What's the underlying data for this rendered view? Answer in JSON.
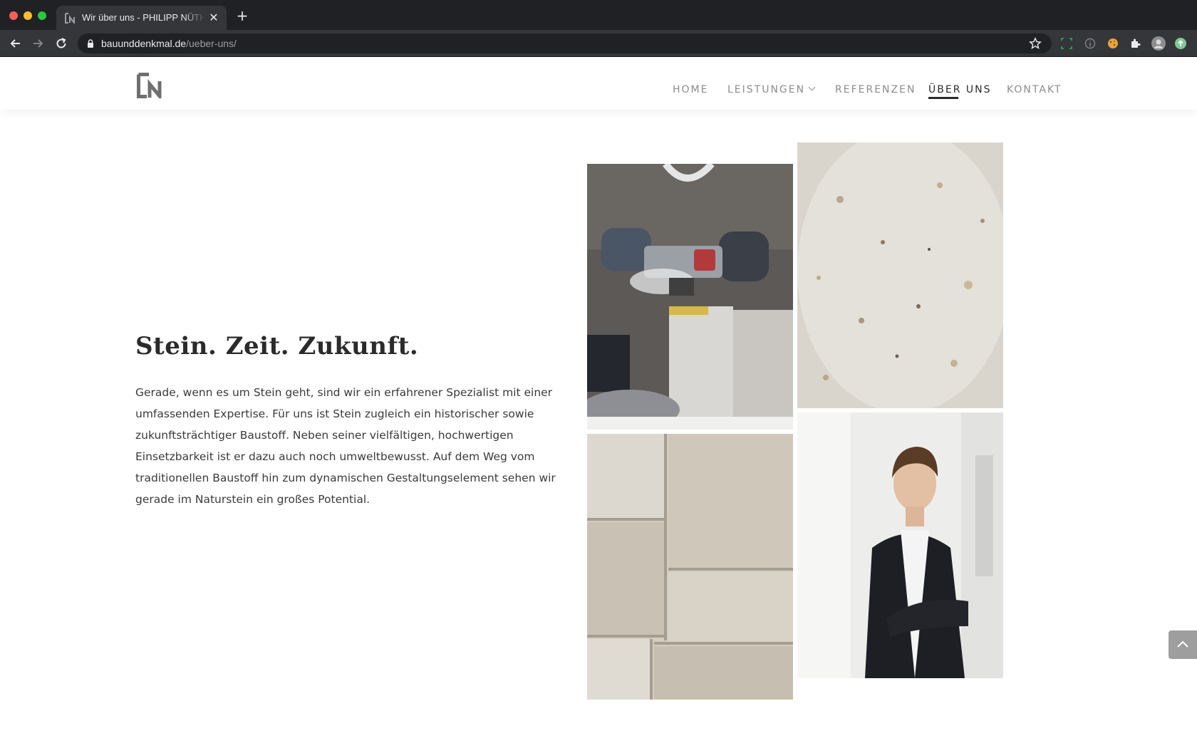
{
  "browser": {
    "tab_title": "Wir über uns - PHILIPP NÜTHE",
    "url_domain": "bauunddenkmal.de",
    "url_path": "/ueber-uns/",
    "tab_close": "✕",
    "new_tab": "+",
    "icons": [
      "back-icon",
      "forward-icon",
      "reload-icon",
      "lock-icon",
      "star-icon",
      "extension-icon",
      "cookie-icon",
      "puzzle-icon",
      "avatar-icon",
      "update-icon"
    ]
  },
  "header": {
    "nav": {
      "home": "HOME",
      "leistungen": "LEISTUNGEN",
      "referenzen": "REFERENZEN",
      "ueber_uns": "ÜBER UNS",
      "kontakt": "KONTAKT"
    },
    "active_item": "ÜBER UNS"
  },
  "main": {
    "heading": "Stein. Zeit. Zukunft.",
    "body": "Gerade, wenn es um Stein geht, sind wir ein erfahrener Spezialist mit einer umfassenden Expertise. Für uns ist Stein zugleich ein historischer sowie zukunftsträchtiger Baustoff. Neben seiner vielfältigen, hochwertigen Einsetzbarkeit ist er dazu auch noch umweltbewusst. Auf dem Weg vom traditionellen Baustoff hin zum dynamischen Gestaltungselement sehen wir gerade im Naturstein ein großes Potential."
  },
  "colors": {
    "text_dark": "#2b2b2b",
    "nav_gray": "#8c8c8c",
    "chrome_dark": "#202124",
    "chrome_mid": "#35363a"
  }
}
